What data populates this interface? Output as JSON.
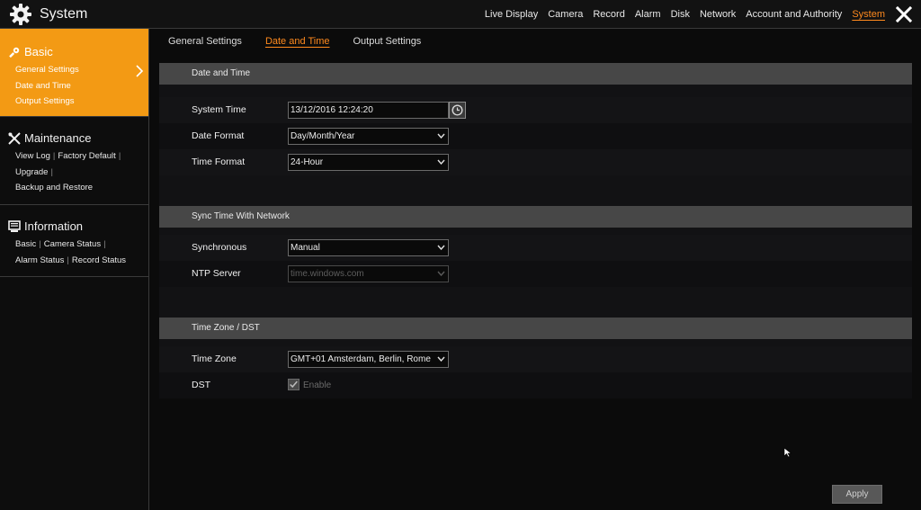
{
  "app": {
    "title": "System"
  },
  "topnav": {
    "items": [
      "Live Display",
      "Camera",
      "Record",
      "Alarm",
      "Disk",
      "Network",
      "Account and Authority",
      "System"
    ],
    "active": "System"
  },
  "sidebar": {
    "basic": {
      "title": "Basic",
      "links": [
        "General Settings",
        "Date and Time",
        "Output Settings"
      ]
    },
    "maintenance": {
      "title": "Maintenance",
      "links": [
        "View Log",
        "Factory Default",
        "Upgrade",
        "Backup and Restore"
      ]
    },
    "information": {
      "title": "Information",
      "links": [
        "Basic",
        "Camera Status",
        "Alarm Status",
        "Record Status"
      ]
    }
  },
  "tabs": {
    "items": [
      "General Settings",
      "Date and Time",
      "Output Settings"
    ],
    "active": "Date and Time"
  },
  "sections": {
    "date_time": {
      "title": "Date and Time",
      "system_time": {
        "label": "System Time",
        "value": "13/12/2016 12:24:20"
      },
      "date_format": {
        "label": "Date Format",
        "value": "Day/Month/Year"
      },
      "time_format": {
        "label": "Time Format",
        "value": "24-Hour"
      }
    },
    "sync": {
      "title": "Sync Time With Network",
      "synchronous": {
        "label": "Synchronous",
        "value": "Manual"
      },
      "ntp_server": {
        "label": "NTP Server",
        "value": "time.windows.com"
      }
    },
    "timezone": {
      "title": "Time Zone / DST",
      "time_zone": {
        "label": "Time Zone",
        "value": "GMT+01 Amsterdam, Berlin, Rome"
      },
      "dst": {
        "label": "DST",
        "checkbox_label": "Enable",
        "checked": true
      }
    }
  },
  "footer": {
    "apply_label": "Apply"
  },
  "colors": {
    "accent": "#ff8a1e",
    "sidebar_active": "#f39a14",
    "band": "#474747"
  },
  "icons": [
    "gear-icon",
    "close-icon",
    "wrench-icon",
    "tools-icon",
    "monitor-icon",
    "chevron-right-icon",
    "clock-icon",
    "caret-down-icon",
    "mouse-cursor-icon"
  ]
}
